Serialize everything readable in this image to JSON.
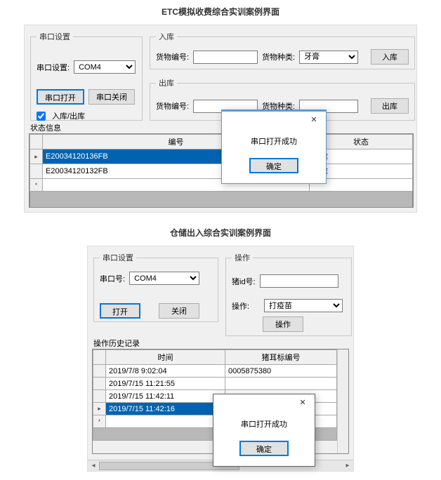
{
  "caption1": "ETC模拟收费综合实训案例界面",
  "caption2": "仓储出入综合实训案例界面",
  "app1": {
    "serialGroup": {
      "legend": "串口设置",
      "portLabel": "串口设置:",
      "portValue": "COM4",
      "openBtn": "串口打开",
      "closeBtn": "串口关闭",
      "checkboxLabel": "入库/出库"
    },
    "inGroup": {
      "legend": "入库",
      "idLabel": "货物编号:",
      "idValue": "",
      "kindLabel": "货物种类:",
      "kindValue": "牙膏",
      "btn": "入库"
    },
    "outGroup": {
      "legend": "出库",
      "idLabel": "货物编号:",
      "idValue": "",
      "kindLabel": "货物种类:",
      "kindValue": "",
      "btn": "出库"
    },
    "statusLabel": "状态信息",
    "gridHeaders": {
      "col1": "编号",
      "col2": "状态"
    },
    "rows": [
      {
        "id": "E20034120136FB",
        "status": "出库",
        "selected": true
      },
      {
        "id": "E20034120132FB",
        "status": "出库",
        "selected": false
      }
    ],
    "dialog": {
      "msg": "串口打开成功",
      "ok": "确定",
      "close": "✕"
    }
  },
  "app2": {
    "serialGroup": {
      "legend": "串口设置",
      "portLabel": "串口号:",
      "portValue": "COM4",
      "openBtn": "打开",
      "closeBtn": "关闭"
    },
    "opGroup": {
      "legend": "操作",
      "pigIdLabel": "猪id号:",
      "pigIdValue": "",
      "opLabel": "操作:",
      "opValue": "打疫苗",
      "btn": "操作"
    },
    "historyLabel": "操作历史记录",
    "gridHeaders": {
      "col1": "时间",
      "col2": "猪耳标编号"
    },
    "rows": [
      {
        "time": "2019/7/8 9:02:04",
        "tag": "0005875380",
        "selected": false
      },
      {
        "time": "2019/7/15 11:21:55",
        "tag": "",
        "selected": false
      },
      {
        "time": "2019/7/15 11:42:11",
        "tag": "",
        "selected": false
      },
      {
        "time": "2019/7/15 11:42:16",
        "tag": "",
        "selected": true
      }
    ],
    "dialog": {
      "msg": "串口打开成功",
      "ok": "确定",
      "close": "✕"
    }
  }
}
